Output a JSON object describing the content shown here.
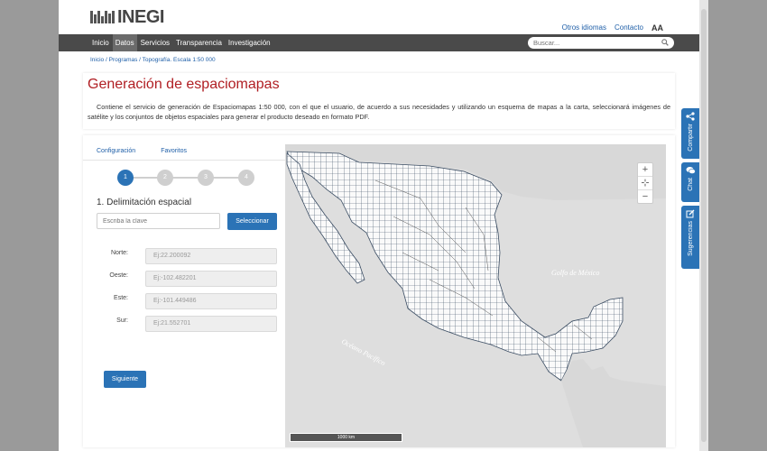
{
  "header": {
    "logo_text": "INEGI",
    "links": [
      "Otros idiomas",
      "Contacto"
    ],
    "font_size_toggle": "AA"
  },
  "nav": {
    "items": [
      "Inicio",
      "Datos",
      "Servicios",
      "Transparencia",
      "Investigación"
    ],
    "active": "Datos",
    "search_placeholder": "Buscar..."
  },
  "breadcrumb": "Inicio / Programas / Topografía. Escala 1:50 000",
  "title": "Generación de espaciomapas",
  "description": "Contiene el servicio de generación de Espaciomapas 1:50 000, con el que el usuario, de acuerdo a sus necesidades y utilizando un esquema de mapas a la carta, seleccionará imágenes de satélite y los conjuntos de objetos espaciales para generar el producto deseado en formato PDF.",
  "tabs": [
    "Configuración",
    "Favoritos"
  ],
  "steps": [
    "1",
    "2",
    "3",
    "4"
  ],
  "active_step": 1,
  "section_title": "1. Delimitación espacial",
  "key_input_placeholder": "Escriba la clave",
  "select_button": "Seleccionar",
  "coordinates": [
    {
      "label": "Norte:",
      "placeholder": "Ej:22.200092"
    },
    {
      "label": "Oeste:",
      "placeholder": "Ej:-102.482201"
    },
    {
      "label": "Este:",
      "placeholder": "Ej:-101.449486"
    },
    {
      "label": "Sur:",
      "placeholder": "Ej:21.552701"
    }
  ],
  "next_button": "Siguiente",
  "map": {
    "zoom_in": "+",
    "pan": "⊹",
    "zoom_out": "−",
    "scale_label": "1000 km",
    "label_gulf": "Golfo de México",
    "label_ocean": "Océano Pacífico"
  },
  "side_tabs": [
    "Compartir",
    "Chat",
    "Sugerencias"
  ],
  "colors": {
    "accent": "#2b73b6",
    "title_red": "#b01e23",
    "nav": "#4a4a4a"
  }
}
